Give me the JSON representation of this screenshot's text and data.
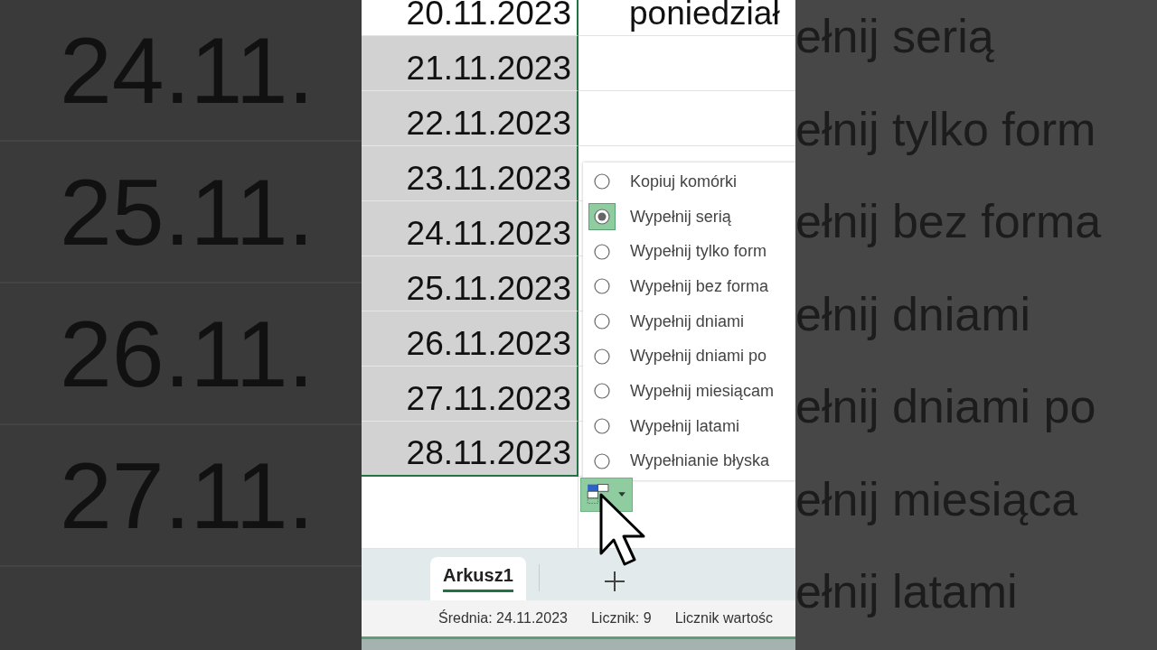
{
  "backdrop_left": {
    "rows": [
      "24.11.",
      "25.11.",
      "26.11.",
      "27.11."
    ]
  },
  "sheet": {
    "rows": [
      {
        "date": "20.11.2023",
        "day": "poniedział",
        "selected": false
      },
      {
        "date": "21.11.2023",
        "selected": true
      },
      {
        "date": "22.11.2023",
        "selected": true
      },
      {
        "date": "23.11.2023",
        "selected": true
      },
      {
        "date": "24.11.2023",
        "selected": true
      },
      {
        "date": "25.11.2023",
        "selected": true
      },
      {
        "date": "26.11.2023",
        "selected": true
      },
      {
        "date": "27.11.2023",
        "selected": true
      },
      {
        "date": "28.11.2023",
        "selected": true
      }
    ]
  },
  "fill_menu": {
    "options": [
      {
        "label": "Kopiuj komórki",
        "selected": false
      },
      {
        "label": "Wypełnij serią",
        "selected": true
      },
      {
        "label": "Wypełnij tylko form",
        "selected": false
      },
      {
        "label": "Wypełnij bez forma",
        "selected": false
      },
      {
        "label": "Wypełnij dniami",
        "selected": false
      },
      {
        "label": "Wypełnij dniami po",
        "selected": false
      },
      {
        "label": "Wypełnij miesiącam",
        "selected": false
      },
      {
        "label": "Wypełnij latami",
        "selected": false
      },
      {
        "label": "Wypełnianie błyska",
        "selected": false
      }
    ]
  },
  "sheet_tabs": [
    {
      "label": "Arkusz1",
      "selected": true
    }
  ],
  "status_bar": [
    "Średnia: 24.11.2023",
    "Licznik: 9",
    "Licznik wartośc"
  ],
  "backdrop_right": {
    "lines": [
      "ełnij serią",
      "ełnij tylko form",
      "ełnij bez forma",
      "ełnij dniami",
      "ełnij dniami po",
      "ełnij miesiąca",
      "ełnij latami"
    ]
  }
}
